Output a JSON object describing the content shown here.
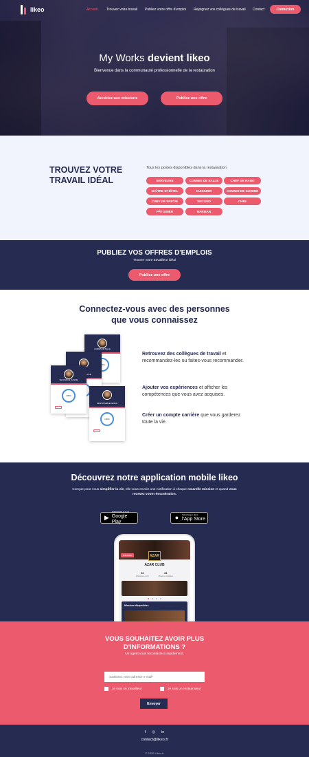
{
  "nav": {
    "logo_text": "likeo",
    "links": [
      "Accueil",
      "Trouvez votre travail",
      "Publiez votre offre d'emploi",
      "Rejoignez vos collègues de travail",
      "Contact"
    ],
    "login": "Connexion"
  },
  "hero": {
    "title_light": "My Works",
    "title_bold": "devient likeo",
    "subtitle": "Bienvenue dans la communauté professionnelle de la restauration",
    "btn_missions": "Accédez aux missions",
    "btn_offer": "Publiez une offre"
  },
  "find": {
    "title": "TROUVEZ VOTRE TRAVAIL IDÉAL",
    "subtitle": "Tous les postes disponibles dans la restauration",
    "tags": [
      "SERVEURS",
      "COMMIS DE SALLE",
      "CHEF DE RANG",
      "MAÎTRE D'HÔTEL",
      "CUISINIER",
      "COMMIS DE CUISINE",
      "CHEF DE PARTIE",
      "SECOND",
      "CHEF",
      "PÂTISSIER",
      "BARMAN"
    ]
  },
  "publish": {
    "title": "PUBLIEZ VOS OFFRES D'EMPLOIS",
    "subtitle": "Trouver votre travailleur idéal",
    "button": "Publiez une offre"
  },
  "connect": {
    "title_line1": "Connectez-vous avec des personnes",
    "title_line2": "que vous connaissez",
    "features": [
      {
        "bold": "Retrouvez des collègues de travail",
        "rest": " et recommandez-les ou faites-vous recommander."
      },
      {
        "bold": "Ajouter vos expériences",
        "rest": " et afficher les compétences que vous avez acquises."
      },
      {
        "bold": "Créer un compte carrière",
        "rest": " que vous garderez toute la vie."
      }
    ],
    "cards": [
      {
        "name": "COMMIS DE SALLE",
        "pct": "100%"
      },
      {
        "name": "CHEF DE PARTIE",
        "pct": "100%"
      },
      {
        "name": "SECOND DE CUISINE",
        "pct": "100%"
      },
      {
        "name": "RESPONSABLE DE BAR",
        "pct": "100%"
      }
    ]
  },
  "app": {
    "title": "Découvrez notre application mobile likeo",
    "desc_1": "Conçue pour vous ",
    "desc_b1": "simplifier la vie",
    "desc_2": ", elle vous envoie une notification à chaque ",
    "desc_b2": "nouvelle mission",
    "desc_3": " et quand ",
    "desc_b3": "vous recevez votre rémunération.",
    "google_small": "DISPONIBLE SUR",
    "google_big": "Google Play",
    "apple_small": "Télécharger dans",
    "apple_big": "l'App Store",
    "screen": {
      "badge": "Suivi Azar",
      "logo": "AZAR",
      "club": "AZAR CLUB",
      "stat1_v": "02",
      "stat1_l": "Missions à venir",
      "stat2_v": "31",
      "stat2_l": "Missions réalisées",
      "missions": "Missions disponibles"
    }
  },
  "contact": {
    "title_line1": "VOUS SOUHAITEZ AVOIR PLUS",
    "title_line2": "D'INFORMATIONS ?",
    "subtitle": "Un agent vous recontactera rapidement.",
    "email_placeholder": "Saisissez votre adresse e-mail*",
    "check_worker": "Je suis un travailleur",
    "check_restaurant": "Je suis un restaurateur",
    "submit": "Envoyer"
  },
  "footer": {
    "email": "contact@likeo.fr",
    "copyright": "© 2020 Likeo.fr"
  },
  "colors": {
    "navy": "#262b52",
    "pink": "#ec5a6e",
    "light": "#f1f4fd"
  }
}
